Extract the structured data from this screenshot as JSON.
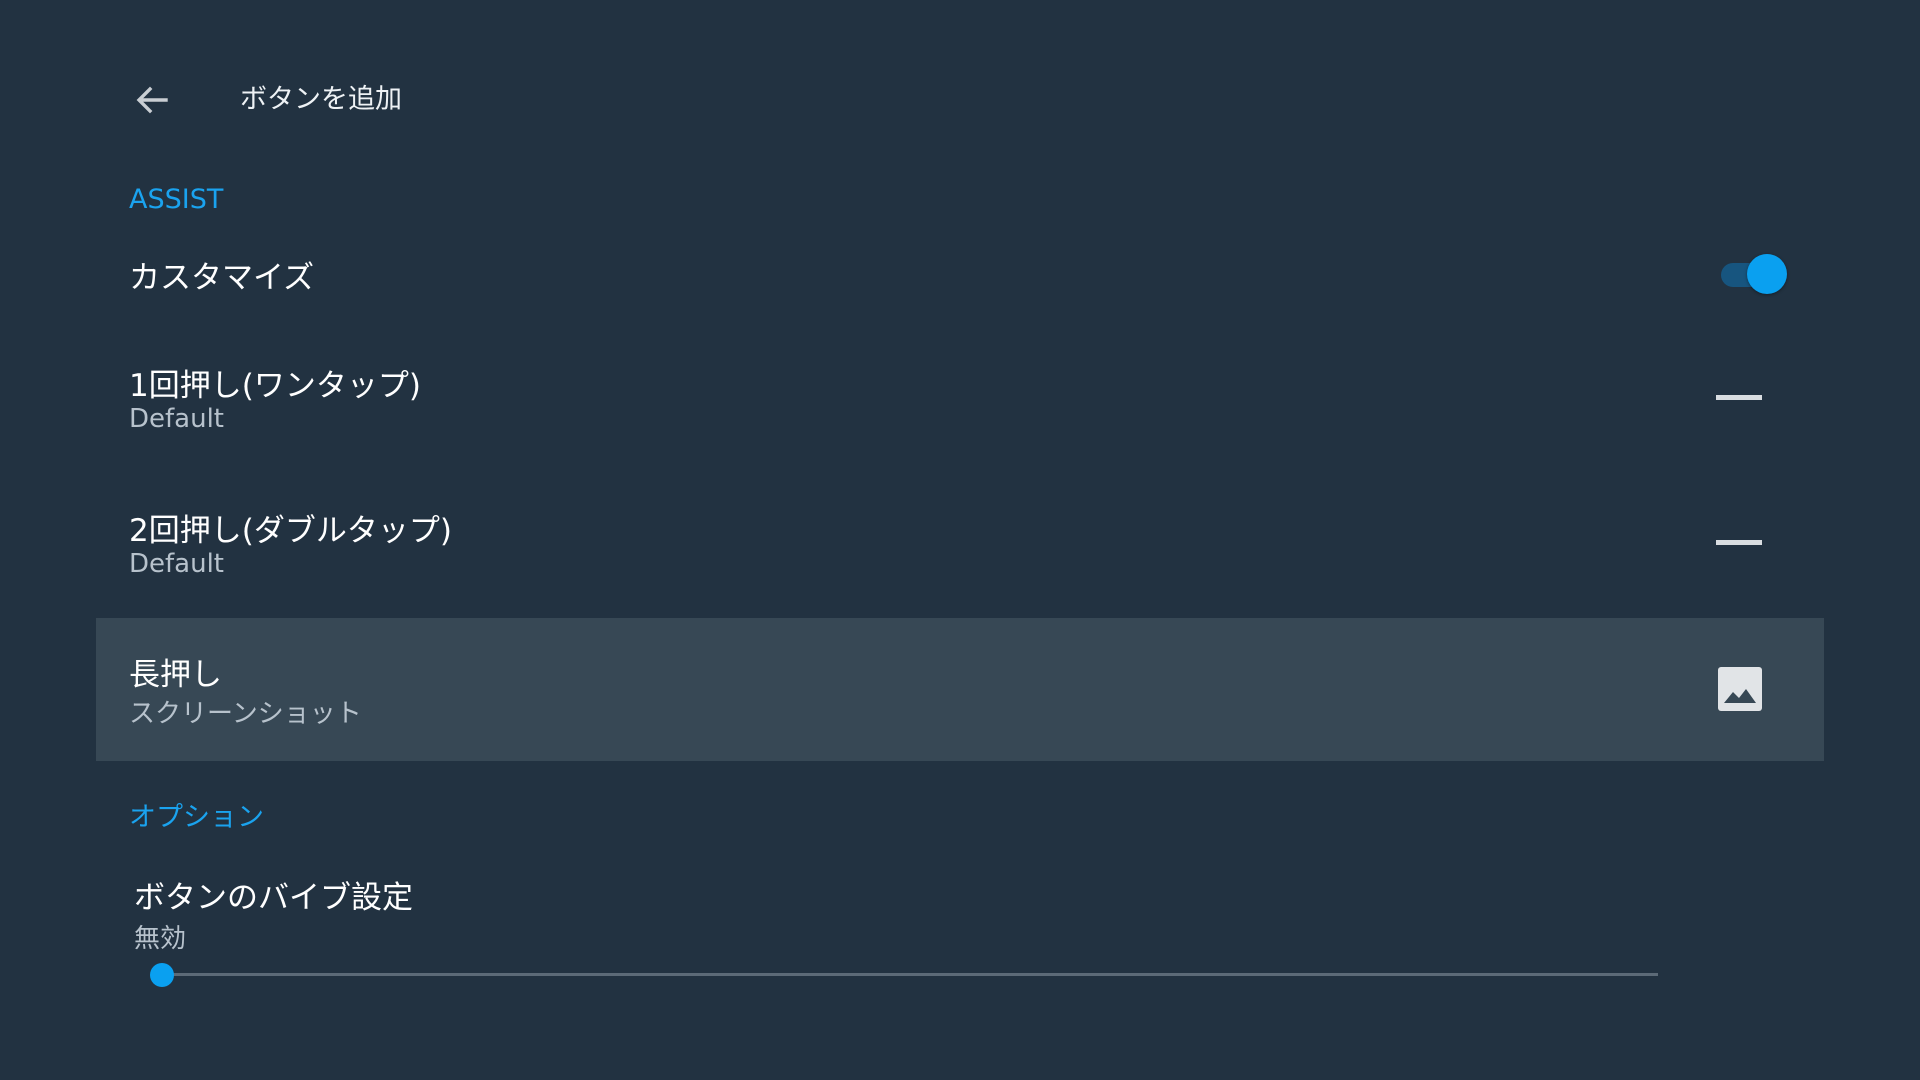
{
  "header": {
    "back_icon": "arrow-back-icon",
    "title": "ボタンを追加"
  },
  "assist": {
    "section_label": "ASSIST",
    "customize": {
      "label": "カスタマイズ",
      "enabled": true
    },
    "single_press": {
      "title": "1回押し(ワンタップ)",
      "subtitle": "Default",
      "icon": "dash-icon"
    },
    "double_press": {
      "title": "2回押し(ダブルタップ)",
      "subtitle": "Default",
      "icon": "dash-icon"
    },
    "long_press": {
      "title": "長押し",
      "subtitle": "スクリーンショット",
      "icon": "image-icon",
      "selected": true
    }
  },
  "options": {
    "section_label": "オプション",
    "vibration": {
      "title": "ボタンのバイブ設定",
      "subtitle": "無効",
      "level": 0
    }
  },
  "colors": {
    "background": "#223241",
    "accent": "#0aa0f0",
    "selected_row": "#374855"
  }
}
